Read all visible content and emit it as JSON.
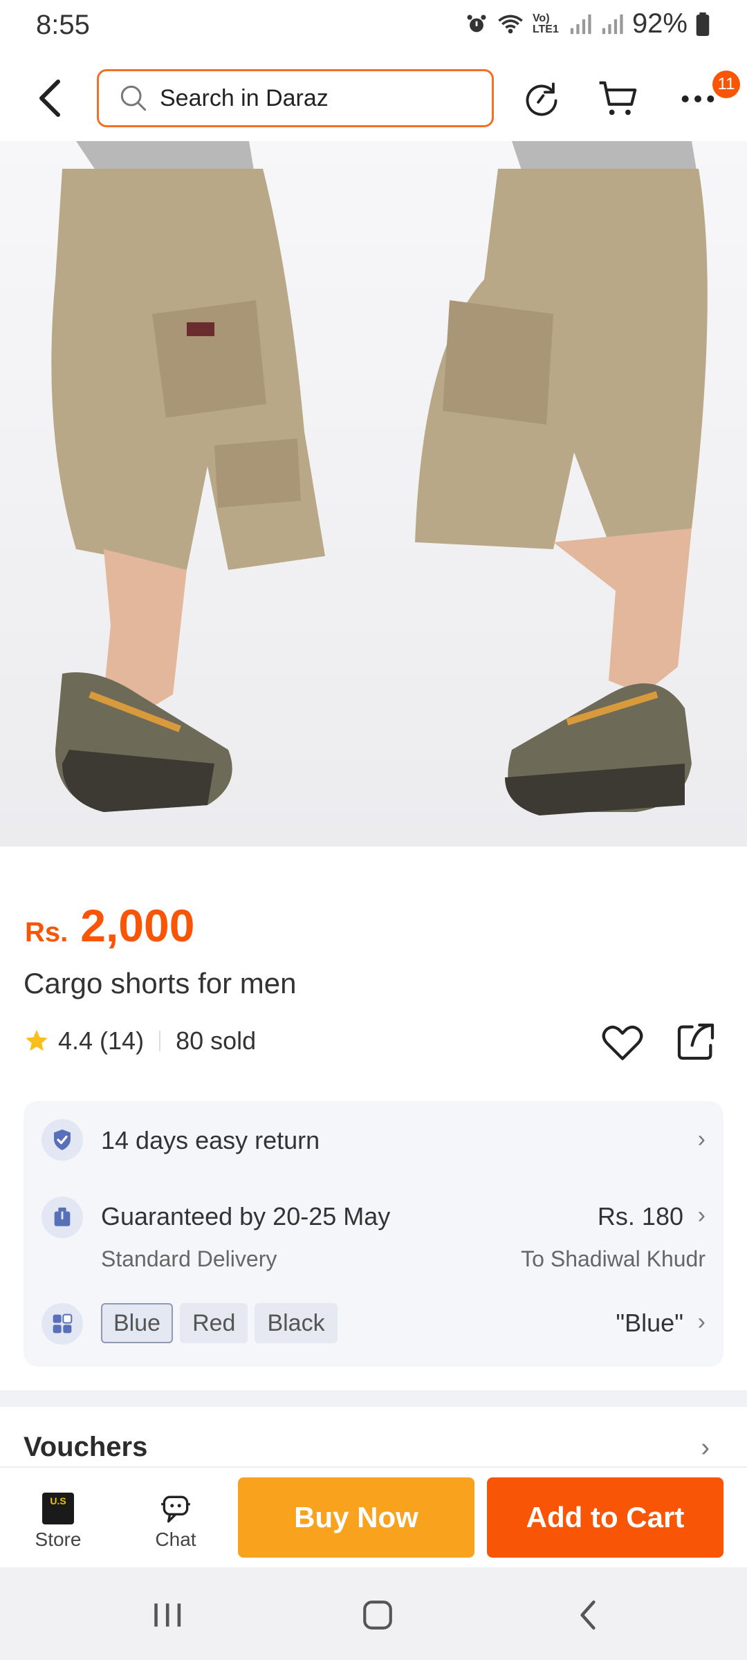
{
  "status_bar": {
    "time": "8:55",
    "network_label": "Vo) LTE1",
    "battery": "92%",
    "icons": [
      "alarm-icon",
      "wifi-icon",
      "signal-icon",
      "battery-icon"
    ]
  },
  "header": {
    "search_placeholder": "Search in Daraz",
    "cart_badge_count": "11",
    "icons": [
      "back-arrow-icon",
      "search-icon",
      "refresh-icon",
      "cart-icon",
      "more-icon"
    ]
  },
  "product": {
    "image_alt": "Cargo shorts for men",
    "price_currency": "Rs.",
    "price_amount": "2,000",
    "title": "Cargo shorts for men",
    "rating": "4.4",
    "rating_count": "(14)",
    "sold": "80 sold"
  },
  "info": {
    "return_text": "14 days easy return",
    "delivery_main": "Guaranteed by 20-25 May",
    "delivery_type": "Standard Delivery",
    "delivery_fee": "Rs. 180",
    "delivery_to": "To Shadiwal Khudr",
    "variants": [
      "Blue",
      "Red",
      "Black"
    ],
    "selected_variant_label": "\"Blue\""
  },
  "vouchers": {
    "title": "Vouchers"
  },
  "action_bar": {
    "store_label": "Store",
    "store_logo_text": "U.S",
    "chat_label": "Chat",
    "buy_now_label": "Buy Now",
    "add_to_cart_label": "Add to Cart"
  },
  "colors": {
    "accent": "#f85606",
    "buy_now": "#f9a21e",
    "search_border": "#f36f21",
    "star": "#f9bf1d"
  }
}
